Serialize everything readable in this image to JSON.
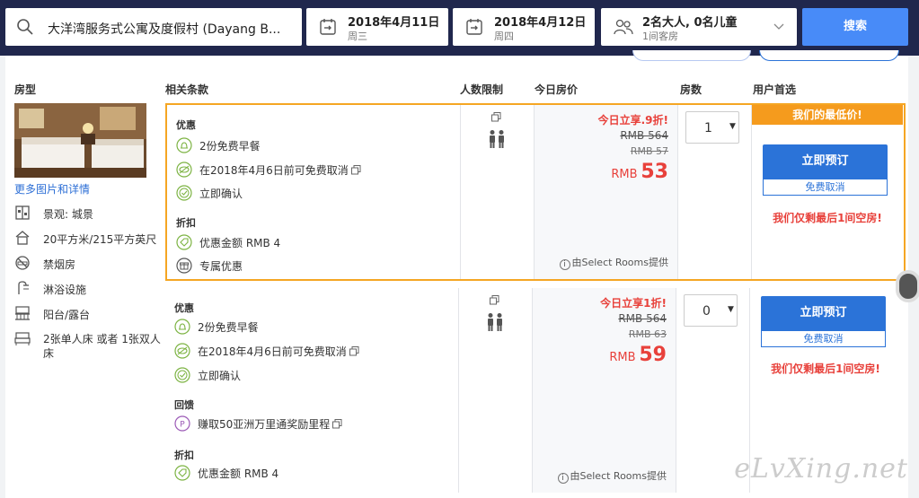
{
  "search": {
    "destination": "大洋湾服务式公寓及度假村 (Dayang B...",
    "checkin_date": "2018年4月11日",
    "checkin_weekday": "周三",
    "checkout_date": "2018年4月12日",
    "checkout_weekday": "周四",
    "guests": "2名大人, 0名儿童",
    "rooms": "1间客房",
    "search_label": "搜索"
  },
  "headers": {
    "room_type": "房型",
    "policies": "相关条款",
    "occupancy": "人数限制",
    "todays_price": "今日房价",
    "rooms": "房数",
    "choice": "用户首选"
  },
  "room": {
    "more_link": "更多图片和详情",
    "features": [
      {
        "icon": "view-icon",
        "label": "景观: 城景"
      },
      {
        "icon": "house-size-icon",
        "label": "20平方米/215平方英尺"
      },
      {
        "icon": "no-smoking-icon",
        "label": "禁烟房"
      },
      {
        "icon": "shower-icon",
        "label": "淋浴设施"
      },
      {
        "icon": "balcony-icon",
        "label": "阳台/露台"
      },
      {
        "icon": "bed-icon",
        "label": "2张单人床 或者 1张双人床"
      }
    ]
  },
  "offers": [
    {
      "sections": [
        {
          "title": "优惠",
          "items": [
            {
              "icon": "breakfast-icon",
              "text": "2份免费早餐"
            },
            {
              "icon": "free-cancel-icon",
              "text": "在2018年4月6日前可免费取消"
            },
            {
              "icon": "confirm-icon",
              "text": "立即确认"
            }
          ]
        },
        {
          "title": "折扣",
          "items": [
            {
              "icon": "coupon-icon",
              "text": "优惠金额 RMB 4"
            },
            {
              "icon": "gift-icon",
              "text": "专属优惠"
            }
          ]
        }
      ],
      "promo": "今日立享.9折!",
      "strike_1": "RMB 564",
      "strike_2": "RMB 57",
      "currency": "RMB",
      "price": "53",
      "provider": "由Select Rooms提供",
      "qty": "1",
      "badge": "我们的最低价!",
      "book_label": "立即预订",
      "free_cancel_label": "免费取消",
      "scarcity": "我们仅剩最后1间空房!"
    },
    {
      "sections": [
        {
          "title": "优惠",
          "items": [
            {
              "icon": "breakfast-icon",
              "text": "2份免费早餐"
            },
            {
              "icon": "free-cancel-icon",
              "text": "在2018年4月6日前可免费取消"
            },
            {
              "icon": "confirm-icon",
              "text": "立即确认"
            }
          ]
        },
        {
          "title": "回馈",
          "items": [
            {
              "icon": "points-icon",
              "text": "赚取50亚洲万里通奖励里程"
            }
          ]
        },
        {
          "title": "折扣",
          "items": [
            {
              "icon": "coupon-icon",
              "text": "优惠金额 RMB 4"
            }
          ]
        }
      ],
      "promo": "今日立享1折!",
      "strike_1": "RMB 564",
      "strike_2": "RMB 63",
      "currency": "RMB",
      "price": "59",
      "provider": "由Select Rooms提供",
      "qty": "0",
      "book_label": "立即预订",
      "free_cancel_label": "免费取消",
      "scarcity": "我们仅剩最后1间空房!"
    }
  ],
  "watermark": "eLvXing.net",
  "colors": {
    "nav": "#20274d",
    "primary": "#2b73d8",
    "accent": "#e8413b",
    "highlight": "#f59b1d"
  }
}
